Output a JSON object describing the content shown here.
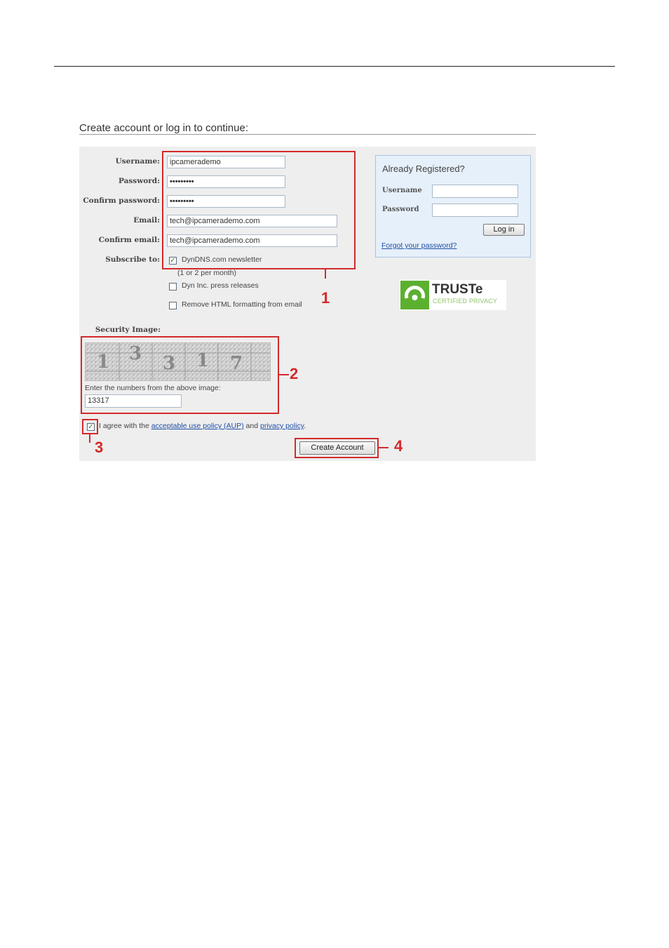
{
  "heading": "Create account or log in to continue:",
  "form": {
    "username_label": "Username:",
    "username_value": "ipcamerademo",
    "password_label": "Password:",
    "password_value": "•••••••••",
    "confirm_password_label": "Confirm password:",
    "confirm_password_value": "•••••••••",
    "email_label": "Email:",
    "email_value": "tech@ipcamerademo.com",
    "confirm_email_label": "Confirm email:",
    "confirm_email_value": "tech@ipcamerademo.com",
    "subscribe_label": "Subscribe to:",
    "options": [
      {
        "label": "DynDNS.com newsletter",
        "checked": true
      },
      {
        "label": "(1 or 2 per month)"
      },
      {
        "label": "Dyn Inc. press releases",
        "checked": false
      },
      {
        "label": "Remove HTML formatting from email",
        "checked": false
      }
    ]
  },
  "security": {
    "label": "Security Image:",
    "digits": [
      "1",
      "3",
      "3",
      "1",
      "7"
    ],
    "prompt": "Enter the numbers from the above image:",
    "value": "13317"
  },
  "agree": {
    "checked": true,
    "text_before": "I agree with the",
    "aup_link": "acceptable use policy (AUP)",
    "and": "and",
    "privacy_link": "privacy policy",
    "period": "."
  },
  "create_button": "Create Account",
  "login": {
    "title": "Already Registered?",
    "username_label": "Username",
    "password_label": "Password",
    "login_button": "Log in",
    "forgot_link": "Forgot your password?"
  },
  "truste": {
    "name": "TRUSTe",
    "subtitle": "CERTIFIED PRIVACY"
  },
  "markers": [
    "1",
    "2",
    "3",
    "4"
  ],
  "colors": {
    "annotation_red": "#d42a2a",
    "link_blue": "#1e4ea8",
    "truste_green": "#5cb030"
  }
}
